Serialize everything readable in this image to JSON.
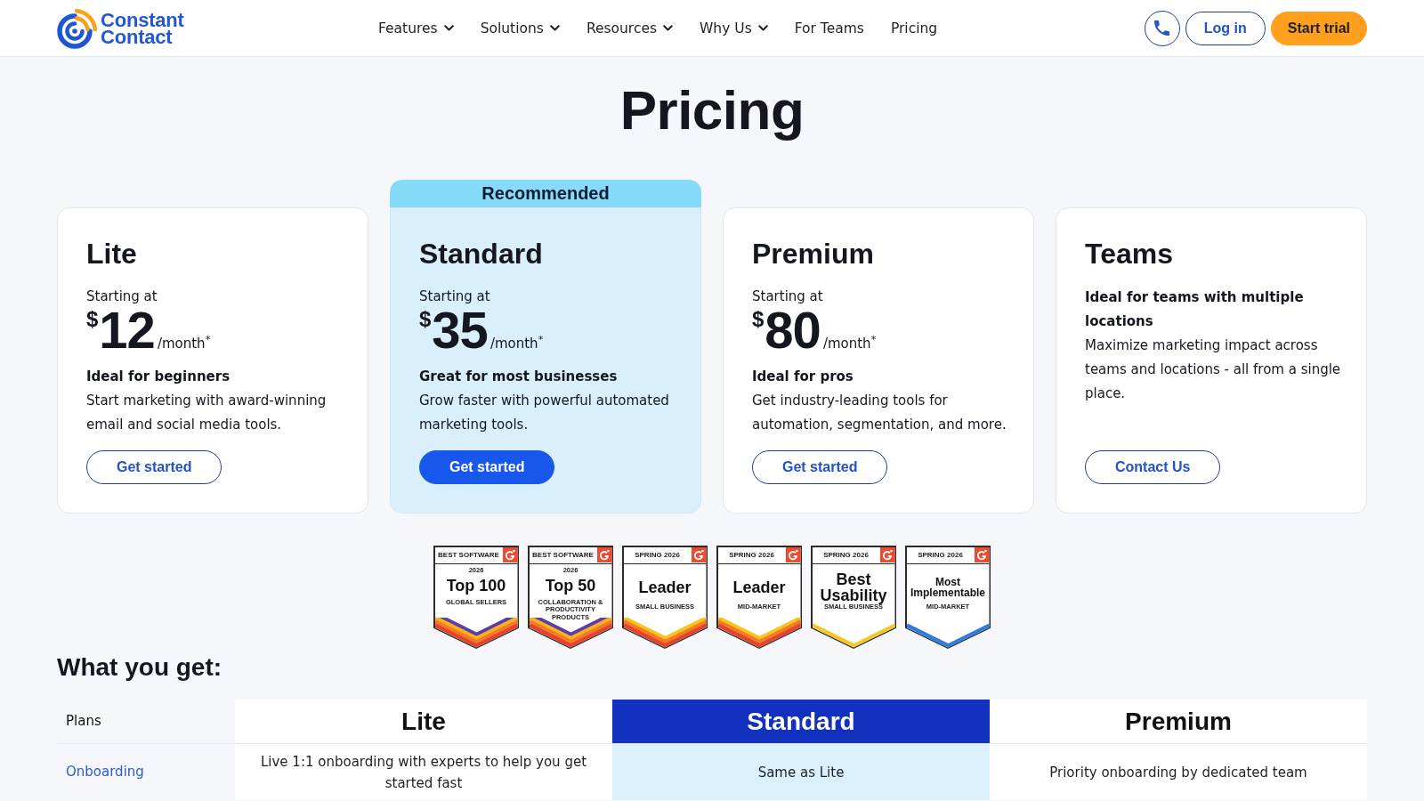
{
  "header": {
    "logo_lines": [
      "Constant",
      "Contact"
    ],
    "nav": [
      {
        "label": "Features",
        "has_menu": true
      },
      {
        "label": "Solutions",
        "has_menu": true
      },
      {
        "label": "Resources",
        "has_menu": true
      },
      {
        "label": "Why Us",
        "has_menu": true
      },
      {
        "label": "For Teams",
        "has_menu": false
      },
      {
        "label": "Pricing",
        "has_menu": false
      }
    ],
    "actions": [
      {
        "kind": "phone"
      },
      {
        "kind": "outline",
        "label": "Log in"
      },
      {
        "kind": "accent",
        "label": "Start trial"
      }
    ]
  },
  "page_title": "Pricing",
  "plans": [
    {
      "name": "Lite",
      "recommended": false,
      "price": {
        "intro": "Starting at",
        "currency": "$",
        "amount": "12",
        "period": "/month$^{*}$"
      },
      "tagline": "Ideal for beginners",
      "description": "Start marketing with award-winning email and social media tools.",
      "button": "Get started"
    },
    {
      "name": "Standard",
      "recommended": true,
      "ribbon": "Recommended",
      "price": {
        "intro": "Starting at",
        "currency": "$",
        "amount": "35",
        "period": "/month$^{*}$"
      },
      "tagline": "Great for most businesses",
      "description": "Grow faster with powerful automated marketing tools.",
      "button": "Get started"
    },
    {
      "name": "Premium",
      "recommended": false,
      "price": {
        "intro": "Starting at",
        "currency": "$",
        "amount": "80",
        "period": "/month$^{*}$"
      },
      "tagline": "Ideal for pros",
      "description": "Get industry-leading tools for automation, segmentation, and more.",
      "button": "Get started"
    },
    {
      "name": "Teams",
      "recommended": false,
      "tagline": "Ideal for teams with multiple locations",
      "description": "Maximize marketing impact across teams and locations - all from a single place.",
      "button": "Contact Us"
    }
  ],
  "awards": [
    {
      "label": "BEST SOFTWARE",
      "year": "2026",
      "title": "Top 100",
      "subtitle": "GLOBAL SELLERS",
      "stripes": [
        {
          "color": "#5b3fa6"
        },
        {
          "color": "#f9b21b"
        },
        {
          "color": "#f47a2a"
        },
        {
          "color": "#e5432b"
        }
      ]
    },
    {
      "label": "BEST SOFTWARE",
      "year": "2026",
      "title": "Top 50",
      "subtitle": "COLLABORATION & PRODUCTIVITY PRODUCTS",
      "stripes": [
        {
          "color": "#5b3fa6"
        },
        {
          "color": "#f9b21b"
        },
        {
          "color": "#f47a2a"
        },
        {
          "color": "#e5432b"
        }
      ]
    },
    {
      "label": "SPRING 2026",
      "title": "Leader",
      "subtitle": "SMALL BUSINESS",
      "stripes": [
        {
          "color": "#f9c51b"
        },
        {
          "color": "#f47a2a"
        },
        {
          "color": "#e5432b"
        }
      ]
    },
    {
      "label": "SPRING 2026",
      "title": "Leader",
      "subtitle": "MID-MARKET",
      "stripes": [
        {
          "color": "#f9c51b"
        },
        {
          "color": "#f47a2a"
        },
        {
          "color": "#e5432b"
        }
      ]
    },
    {
      "label": "SPRING 2026",
      "title": "Best Usability",
      "subtitle": "SMALL BUSINESS",
      "stripes": [
        {
          "color": "#f5c91f"
        }
      ]
    },
    {
      "label": "SPRING 2026",
      "title": "Most Implementable",
      "subtitle": "MID-MARKET",
      "stripes": [
        {
          "color": "#2f7de1"
        }
      ]
    }
  ],
  "comparison": {
    "title": "What you get:",
    "header_label": "Plans",
    "plan_columns": [
      {
        "label": "Lite",
        "highlighted": false
      },
      {
        "label": "Standard",
        "highlighted": true
      },
      {
        "label": "Premium",
        "highlighted": false
      }
    ],
    "rows": [
      {
        "feature": "Onboarding",
        "cells": [
          "Live 1:1 onboarding with experts to help you get started fast",
          "Same as Lite",
          "Priority onboarding by dedicated team"
        ]
      }
    ]
  }
}
